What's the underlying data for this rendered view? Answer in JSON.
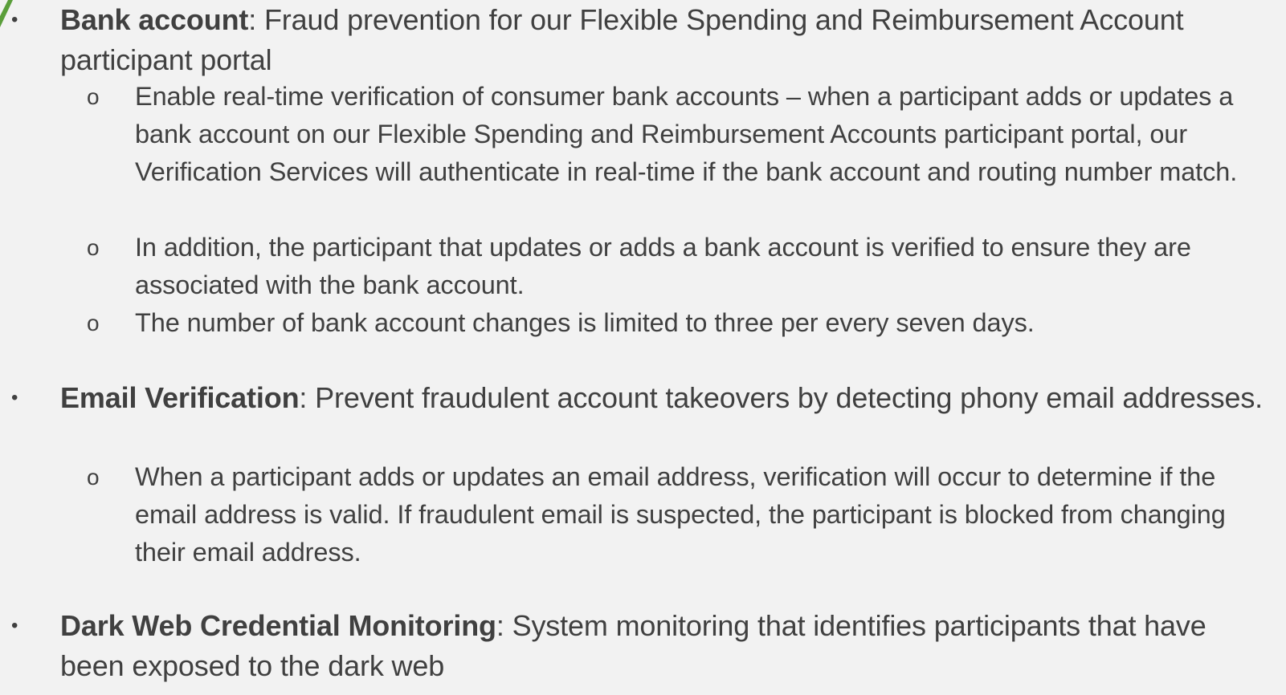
{
  "colors": {
    "background": "#f2f2f2",
    "text": "#404040",
    "accent": "#5a9e3a"
  },
  "bullet_marker": "•",
  "sub_marker": "o",
  "bullets": [
    {
      "heading": "Bank account",
      "text": ": Fraud prevention for our Flexible Spending and Reimbursement Account participant portal",
      "subs": [
        "Enable real-time verification of consumer bank accounts – when a participant adds or updates a bank account on our Flexible Spending and Reimbursement Accounts participant portal, our Verification Services will authenticate in real-time if the bank account and routing number match.",
        "In addition, the participant that updates or adds a bank account is verified to ensure they are associated with the bank account.",
        "The number of bank account changes is limited to three per every seven days."
      ]
    },
    {
      "heading": "Email Verification",
      "text": ": Prevent fraudulent account takeovers by detecting phony email addresses.",
      "subs": [
        "When a participant adds or updates an email address, verification will occur to determine if the email address is valid. If fraudulent email is suspected, the participant is blocked from changing their email address."
      ]
    },
    {
      "heading": "Dark Web Credential Monitoring",
      "text": ": System monitoring that identifies participants that have been exposed to the dark web",
      "subs": []
    }
  ]
}
